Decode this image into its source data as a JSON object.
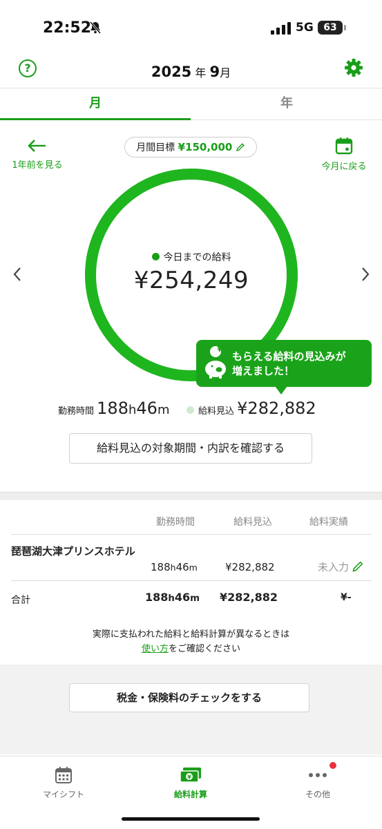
{
  "status": {
    "time": "22:52",
    "network": "5G",
    "battery": "63"
  },
  "header": {
    "year": "2025",
    "year_suffix": "年",
    "month": "9",
    "month_suffix": "月"
  },
  "tabs": [
    {
      "label": "月",
      "active": true
    },
    {
      "label": "年",
      "active": false
    }
  ],
  "nav": {
    "prev_label": "1年前を見る",
    "today_label": "今月に戻る"
  },
  "goal": {
    "label": "月間目標",
    "amount": "¥150,000"
  },
  "ring": {
    "label": "今日までの給料",
    "value": "¥254,249",
    "progress": 1.0
  },
  "tooltip": {
    "line1": "もらえる給料の見込みが",
    "line2": "増えました！",
    "coin_symbol": "¥"
  },
  "summary": {
    "work_label": "勤務時間",
    "work_h": "188",
    "work_h_unit": "h",
    "work_m": "46",
    "work_m_unit": "m",
    "forecast_label": "給料見込",
    "forecast_value": "¥282,882"
  },
  "detail_button": "給料見込の対象期間・内訳を確認する",
  "table": {
    "headers": {
      "hours": "勤務時間",
      "forecast": "給料見込",
      "actual": "給料実績"
    },
    "rows": [
      {
        "employer": "琵琶湖大津プリンスホテル",
        "hours_h": "188",
        "hours_m": "46",
        "forecast": "¥282,882",
        "actual": "未入力"
      }
    ],
    "total": {
      "label": "合計",
      "hours_h": "188",
      "hours_m": "46",
      "forecast": "¥282,882",
      "actual": "¥-"
    }
  },
  "note": {
    "line1": "実際に支払われた給料と給料計算が異なるときは",
    "link": "使い方",
    "line2_rest": "をご確認ください"
  },
  "tax_button": "税金・保険料のチェックをする",
  "tabbar": [
    {
      "label": "マイシフト"
    },
    {
      "label": "給料計算",
      "active": true
    },
    {
      "label": "その他"
    }
  ],
  "colors": {
    "accent": "#1a9e1a",
    "ring": "#1fb51f",
    "badge": "#e8333f"
  }
}
